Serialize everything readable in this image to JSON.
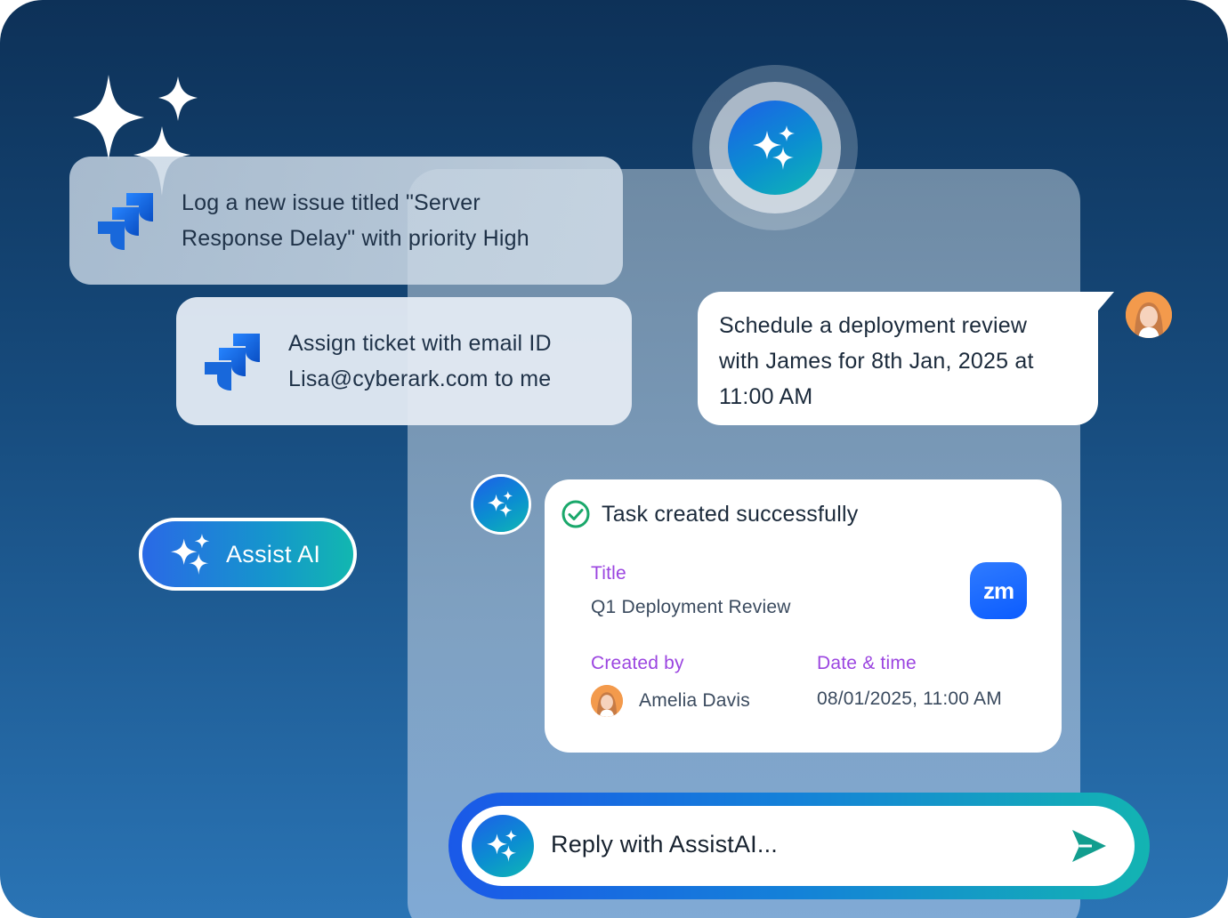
{
  "jira_requests": [
    {
      "line1": "Log a new issue titled \"Server",
      "line2": "Response Delay\" with priority High"
    },
    {
      "line1": "Assign ticket with email ID",
      "line2": "Lisa@cyberark.com to me"
    }
  ],
  "user_message": {
    "line1": "Schedule a deployment review",
    "line2": "with James for 8th Jan, 2025 at",
    "line3": "11:00 AM"
  },
  "assist_button": {
    "label": "Assist AI"
  },
  "task_card": {
    "status": "Task created successfully",
    "title_label": "Title",
    "title_value": "Q1 Deployment Review",
    "created_by_label": "Created by",
    "created_by_value": "Amelia Davis",
    "datetime_label": "Date & time",
    "datetime_value": "08/01/2025, 11:00 AM",
    "app_badge": "zm"
  },
  "reply": {
    "placeholder": "Reply with AssistAI..."
  },
  "colors": {
    "accent_purple": "#9b45e0",
    "success_green": "#1aa86b",
    "send_teal": "#129e8f",
    "jira_blue": "#1868db"
  },
  "icons": [
    "sparkles-icon",
    "jira-icon",
    "check-circle-icon",
    "zoom-icon",
    "send-icon",
    "avatar"
  ]
}
